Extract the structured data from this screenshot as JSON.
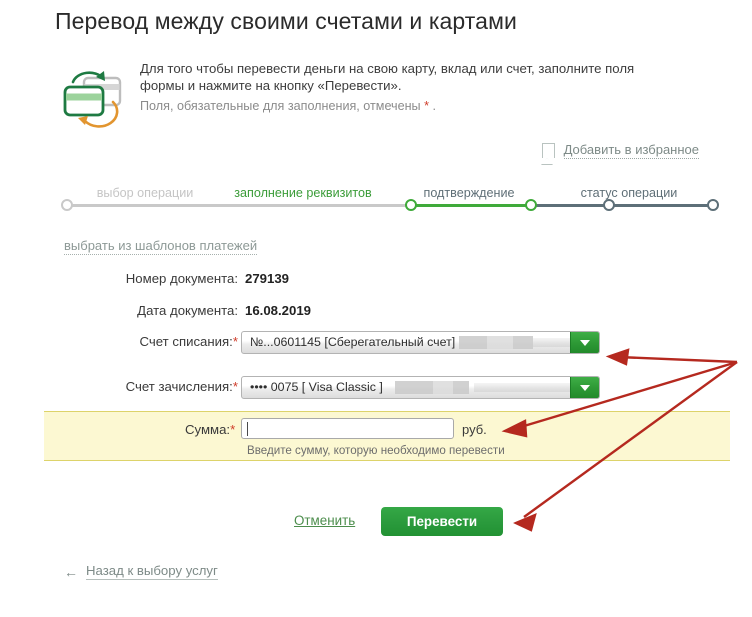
{
  "page": {
    "title": "Перевод между своими счетами и картами"
  },
  "intro": {
    "icon": "card-transfer-icon",
    "line1": "Для того чтобы перевести деньги на свою карту, вклад или счет, заполните поля",
    "line2": "формы и нажмите на кнопку «Перевести».",
    "note_before": "Поля, обязательные для заполнения, отмечены ",
    "note_star": "*",
    "note_after": " ."
  },
  "favourites": {
    "icon": "bookmark-flag-icon",
    "label": "Добавить в избранное"
  },
  "stepper": {
    "steps": [
      {
        "label": "выбор операции",
        "state": "done"
      },
      {
        "label": "заполнение реквизитов",
        "state": "active"
      },
      {
        "label": "подтверждение",
        "state": "todo"
      },
      {
        "label": "статус операции",
        "state": "todo"
      }
    ]
  },
  "templates_link": {
    "label": "выбрать из шаблонов платежей"
  },
  "form": {
    "doc_number": {
      "label": "Номер документа:",
      "value": "279139"
    },
    "doc_date": {
      "label": "Дата документа:",
      "value": "16.08.2019"
    },
    "debit_account": {
      "label": "Счет списания:",
      "required": "*",
      "value": "№...0601145  [Сберегательный счет]",
      "dropdown_icon": "chevron-down-icon"
    },
    "credit_account": {
      "label": "Счет зачисления:",
      "required": "*",
      "value": "•••• 0075   [ Visa Classic ]",
      "dropdown_icon": "chevron-down-icon"
    },
    "amount": {
      "label": "Сумма:",
      "required": "*",
      "value": "",
      "placeholder": "",
      "unit": "руб.",
      "hint": "Введите сумму, которую необходимо перевести"
    }
  },
  "actions": {
    "cancel_label": "Отменить",
    "submit_label": "Перевести"
  },
  "back_link": {
    "arrow_icon": "arrow-left-icon",
    "label": "Назад к выбору услуг"
  },
  "annotations": {
    "color": "#b5291f",
    "arrows": [
      {
        "name": "arrow-to-debit-account",
        "from": [
          737,
          362
        ],
        "to": [
          609,
          357
        ]
      },
      {
        "name": "arrow-to-amount-field",
        "from": [
          737,
          362
        ],
        "to": [
          505,
          431
        ]
      },
      {
        "name": "arrow-to-submit-button",
        "from": [
          737,
          362
        ],
        "to": [
          516,
          523
        ]
      }
    ]
  },
  "colors": {
    "brand_green": "#2a9a3c",
    "step_active": "#3faa3a",
    "step_todo": "#5d6f78",
    "highlight_band": "#fcf8d2",
    "annotation_red": "#b5291f"
  }
}
